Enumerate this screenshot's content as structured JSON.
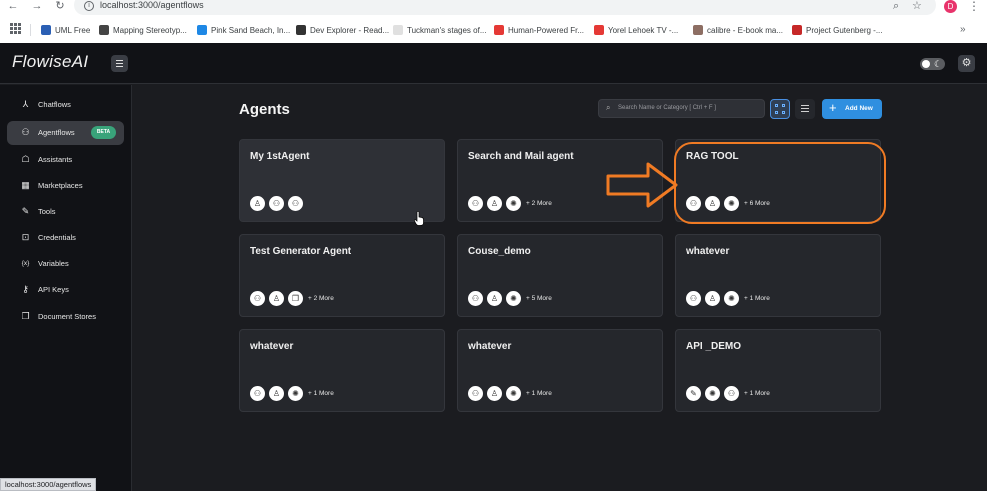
{
  "browser": {
    "url": "localhost:3000/agentflows",
    "avatar_letter": "D",
    "bookmarks": [
      {
        "label": "UML Free",
        "color": "#2b5fb4"
      },
      {
        "label": "Mapping Stereotyp...",
        "color": "#444444"
      },
      {
        "label": "Pink Sand Beach, In...",
        "color": "#1e88e5"
      },
      {
        "label": "Dev Explorer - Read...",
        "color": "#333333"
      },
      {
        "label": "Tuckman's stages of...",
        "color": "#e0e0e0"
      },
      {
        "label": "Human-Powered Fr...",
        "color": "#e53935"
      },
      {
        "label": "Yorel Lehoek TV -...",
        "color": "#e53935"
      },
      {
        "label": "calibre - E-book ma...",
        "color": "#8d6e63"
      },
      {
        "label": "Project Gutenberg -...",
        "color": "#c62828"
      }
    ],
    "status_url": "localhost:3000/agentflows"
  },
  "app": {
    "logo": "FlowiseAI",
    "theme": "dark"
  },
  "sidebar": {
    "items": [
      {
        "label": "Chatflows",
        "icon": "chatflow-icon",
        "glyph": "⅄",
        "active": false
      },
      {
        "label": "Agentflows",
        "icon": "agent-icon",
        "glyph": "⚇",
        "active": true,
        "badge": "BETA"
      },
      {
        "label": "Assistants",
        "icon": "robot-icon",
        "glyph": "☖",
        "active": false
      },
      {
        "label": "Marketplaces",
        "icon": "store-icon",
        "glyph": "▦",
        "active": false
      },
      {
        "label": "Tools",
        "icon": "tool-icon",
        "glyph": "✎",
        "active": false
      },
      {
        "label": "Credentials",
        "icon": "lock-icon",
        "glyph": "⊡",
        "active": false
      },
      {
        "label": "Variables",
        "icon": "variable-icon",
        "glyph": "{x}",
        "active": false
      },
      {
        "label": "API Keys",
        "icon": "key-icon",
        "glyph": "⚷",
        "active": false
      },
      {
        "label": "Document Stores",
        "icon": "document-icon",
        "glyph": "❐",
        "active": false
      }
    ]
  },
  "main": {
    "title": "Agents",
    "search_placeholder": "Search Name or Category [ Ctrl + F ]",
    "add_label": "Add New",
    "cards": [
      {
        "title": "My 1stAgent",
        "icons": [
          "person-icon",
          "agent-icon",
          "agent-icon"
        ],
        "more": ""
      },
      {
        "title": "Search and Mail agent",
        "icons": [
          "agent-icon",
          "person-icon",
          "openai-icon"
        ],
        "more": "+ 2 More"
      },
      {
        "title": "RAG TOOL",
        "icons": [
          "agent-icon",
          "person-icon",
          "openai-icon"
        ],
        "more": "+ 6 More"
      },
      {
        "title": "Test Generator Agent",
        "icons": [
          "agent-icon",
          "person-icon",
          "document-icon"
        ],
        "more": "+ 2 More"
      },
      {
        "title": "Couse_demo",
        "icons": [
          "agent-icon",
          "person-icon",
          "openai-icon"
        ],
        "more": "+ 5 More"
      },
      {
        "title": "whatever",
        "icons": [
          "agent-icon",
          "person-icon",
          "openai-icon"
        ],
        "more": "+ 1 More"
      },
      {
        "title": "whatever",
        "icons": [
          "agent-icon",
          "person-icon",
          "openai-icon"
        ],
        "more": "+ 1 More"
      },
      {
        "title": "whatever",
        "icons": [
          "agent-icon",
          "person-icon",
          "openai-icon"
        ],
        "more": "+ 1 More"
      },
      {
        "title": "API _DEMO",
        "icons": [
          "tool-icon",
          "openai-icon",
          "agent-icon"
        ],
        "more": "+ 1 More"
      }
    ]
  },
  "annotation": {
    "color": "#f07b24",
    "highlighted_card": "RAG TOOL"
  }
}
